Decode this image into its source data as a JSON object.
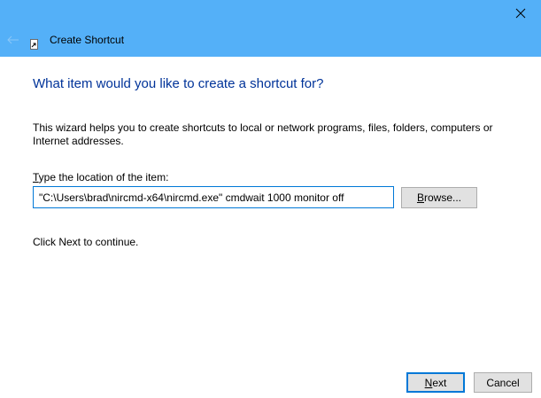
{
  "window": {
    "title": "Create Shortcut",
    "close_icon": "close-icon",
    "back_icon": "back-arrow-icon",
    "app_icon": "shortcut-icon",
    "titlebar_color": "#54b0f8"
  },
  "wizard": {
    "heading": "What item would you like to create a shortcut for?",
    "description": "This wizard helps you to create shortcuts to local or network programs, files, folders, computers or Internet addresses.",
    "location_label_accesskey": "T",
    "location_label_rest": "ype the location of the item:",
    "location_value": "\"C:\\Users\\brad\\nircmd-x64\\nircmd.exe\" cmdwait 1000 monitor off",
    "browse_accesskey": "B",
    "browse_rest": "rowse...",
    "continue_text": "Click Next to continue.",
    "heading_color": "#003399"
  },
  "footer": {
    "next_accesskey": "N",
    "next_rest": "ext",
    "cancel_label": "Cancel"
  }
}
